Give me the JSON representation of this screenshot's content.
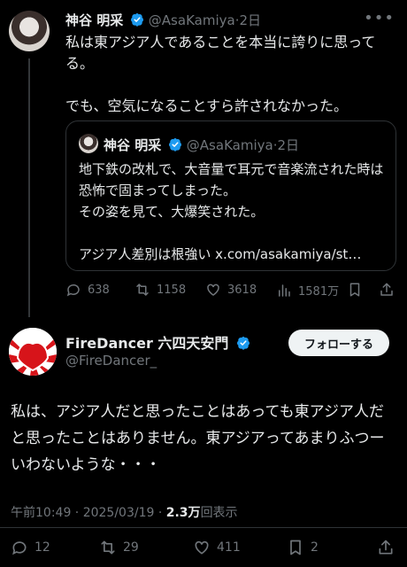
{
  "main_tweet": {
    "name": "神谷 明采",
    "handle": "@AsaKamiya",
    "separator": "·",
    "time": "2日",
    "text": "私は東アジア人であることを本当に誇りに思ってる。\n\nでも、空気になることすら許されなかった。",
    "quote": {
      "name": "神谷 明采",
      "handle": "@AsaKamiya",
      "separator": "·",
      "time": "2日",
      "text": "地下鉄の改札で、大音量で耳元で音楽流された時は恐怖で固まってしまった。\nその姿を見て、大爆笑された。\n\nアジア人差別は根強い x.com/asakamiya/st…"
    },
    "actions": {
      "replies": "638",
      "reposts": "1158",
      "likes": "3618",
      "views": "1581万"
    }
  },
  "reply_tweet": {
    "name": "FireDancer 六四天安門",
    "handle": "@FireDancer_",
    "follow_label": "フォローする",
    "text": "私は、アジア人だと思ったことはあっても東アジア人だと思ったことはありません。東アジアってあまりふつーいわないような・・・",
    "timestamp": "午前10:49 · 2025/03/19 · ",
    "views_count": "2.3万",
    "views_label": "回表示",
    "actions": {
      "replies": "12",
      "reposts": "29",
      "likes": "411",
      "bookmarks": "2"
    }
  },
  "colors": {
    "background": "#000000",
    "text": "#e7e9ea",
    "muted": "#71767b",
    "verified": "#1d9bf0",
    "border": "#2f3336"
  }
}
